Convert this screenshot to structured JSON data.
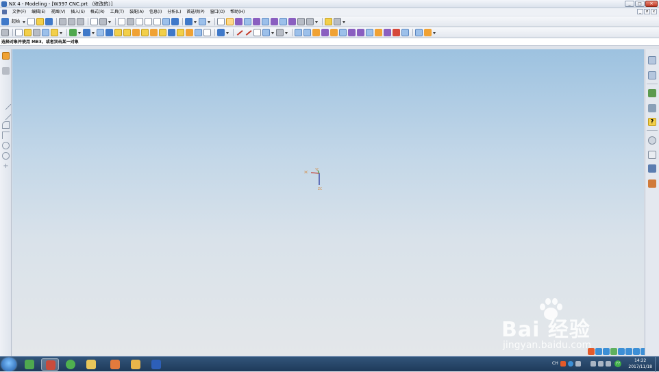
{
  "window": {
    "title": "NX 4 - Modeling - [W397 CNC.prt （修改的）]",
    "buttons": [
      "_",
      "□",
      "✕"
    ]
  },
  "menubar": {
    "items": [
      "文件(F)",
      "编辑(E)",
      "视图(V)",
      "插入(S)",
      "格式(R)",
      "工具(T)",
      "装配(A)",
      "信息(I)",
      "分析(L)",
      "首选项(P)",
      "窗口(O)",
      "帮助(H)"
    ],
    "mdi_buttons": [
      "_",
      "σ",
      "x"
    ]
  },
  "toolbar": {
    "start_label": "起始"
  },
  "status": {
    "prompt": "选择对象并使用 MB3，或者双击某一对象"
  },
  "viewport": {
    "background_top": "#9dc2e0",
    "background_bottom": "#e4e7ea",
    "csys": {
      "x_label": "XC",
      "y_label": "YC",
      "z_label": "ZC"
    }
  },
  "watermark": {
    "brand": "Bai 经验",
    "url": "jingyan.baidu.com"
  },
  "taskbar": {
    "tray_lang": "CH",
    "time": "14:22",
    "date": "2017/11/18",
    "badge": "77"
  },
  "icons": {
    "window": "nx-app-icon",
    "start": "windows-start-icon"
  }
}
